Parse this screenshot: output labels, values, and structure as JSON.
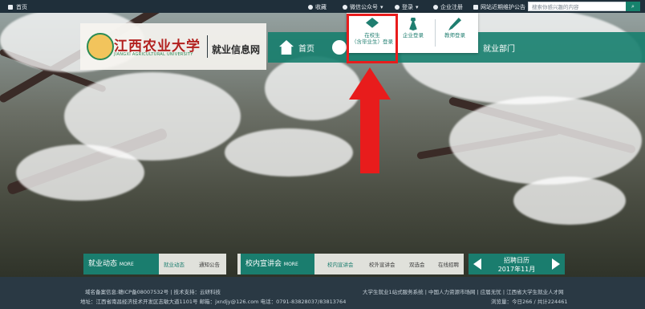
{
  "topbar": {
    "home": "首页",
    "favorite": "收藏",
    "wechat": "微信公众号",
    "login": "登录",
    "company_register": "企业注册",
    "notice": "网站近期维护公告",
    "search_placeholder": "搜索你感兴趣的内容"
  },
  "logo": {
    "university_cn": "江西农业大学",
    "university_en": "JIANGXI AGRICULTURAL UNIVERSITY",
    "site_name": "就业信息网"
  },
  "nav": {
    "home": "首页",
    "dept": "就业部门"
  },
  "login_menu": {
    "student": [
      "在校生",
      "（含毕业生）登录"
    ],
    "company": "企业登录",
    "teacher": "教师登录"
  },
  "bottom_bar": {
    "news_tab": "就业动态",
    "more": "MORE",
    "news_links": [
      "就业动态",
      "通知公告"
    ],
    "career_tab": "校内宣讲会",
    "career_links": [
      "校内宣讲会",
      "校外宣讲会",
      "双选会",
      "在线招聘"
    ],
    "calendar_title": "招聘日历",
    "calendar_month": "2017年11月"
  },
  "footer": {
    "left_line1": "域名备案信息:赣ICP备08007532号  |  技术支持：云研科技",
    "left_line2": "地址：江西省南昌经济技术开发区志敏大道1101号 邮箱：jxndjy@126.com 电话：0791-83828037/83813764",
    "right_line1": "大学生就业1站式服务系统  |  中国人力资源市场网  |  应届无忧  |  江西省大学生就业人才网",
    "right_line2": "浏览量：今日266 / 共计224461"
  },
  "colors": {
    "topbar": "#1f2f3a",
    "primary": "#1a7d6e",
    "highlight": "#e81c1c",
    "footer": "#2a3944"
  }
}
